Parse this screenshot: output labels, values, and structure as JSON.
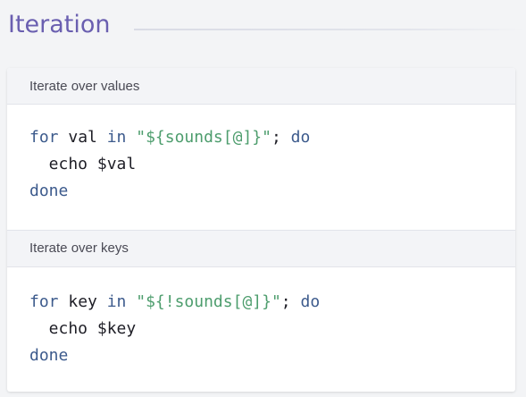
{
  "header": {
    "title": "Iteration"
  },
  "sections": [
    {
      "label": "Iterate over values",
      "code": {
        "line1": {
          "kw_for": "for",
          "var": " val ",
          "kw_in": "in",
          "space": " ",
          "string": "\"${sounds[@]}\"",
          "semicolon": "; ",
          "kw_do": "do"
        },
        "line2": "  echo $val",
        "line3": "done"
      }
    },
    {
      "label": "Iterate over keys",
      "code": {
        "line1": {
          "kw_for": "for",
          "var": " key ",
          "kw_in": "in",
          "space": " ",
          "string": "\"${!sounds[@]}\"",
          "semicolon": "; ",
          "kw_do": "do"
        },
        "line2": "  echo $key",
        "line3": "done"
      }
    }
  ]
}
